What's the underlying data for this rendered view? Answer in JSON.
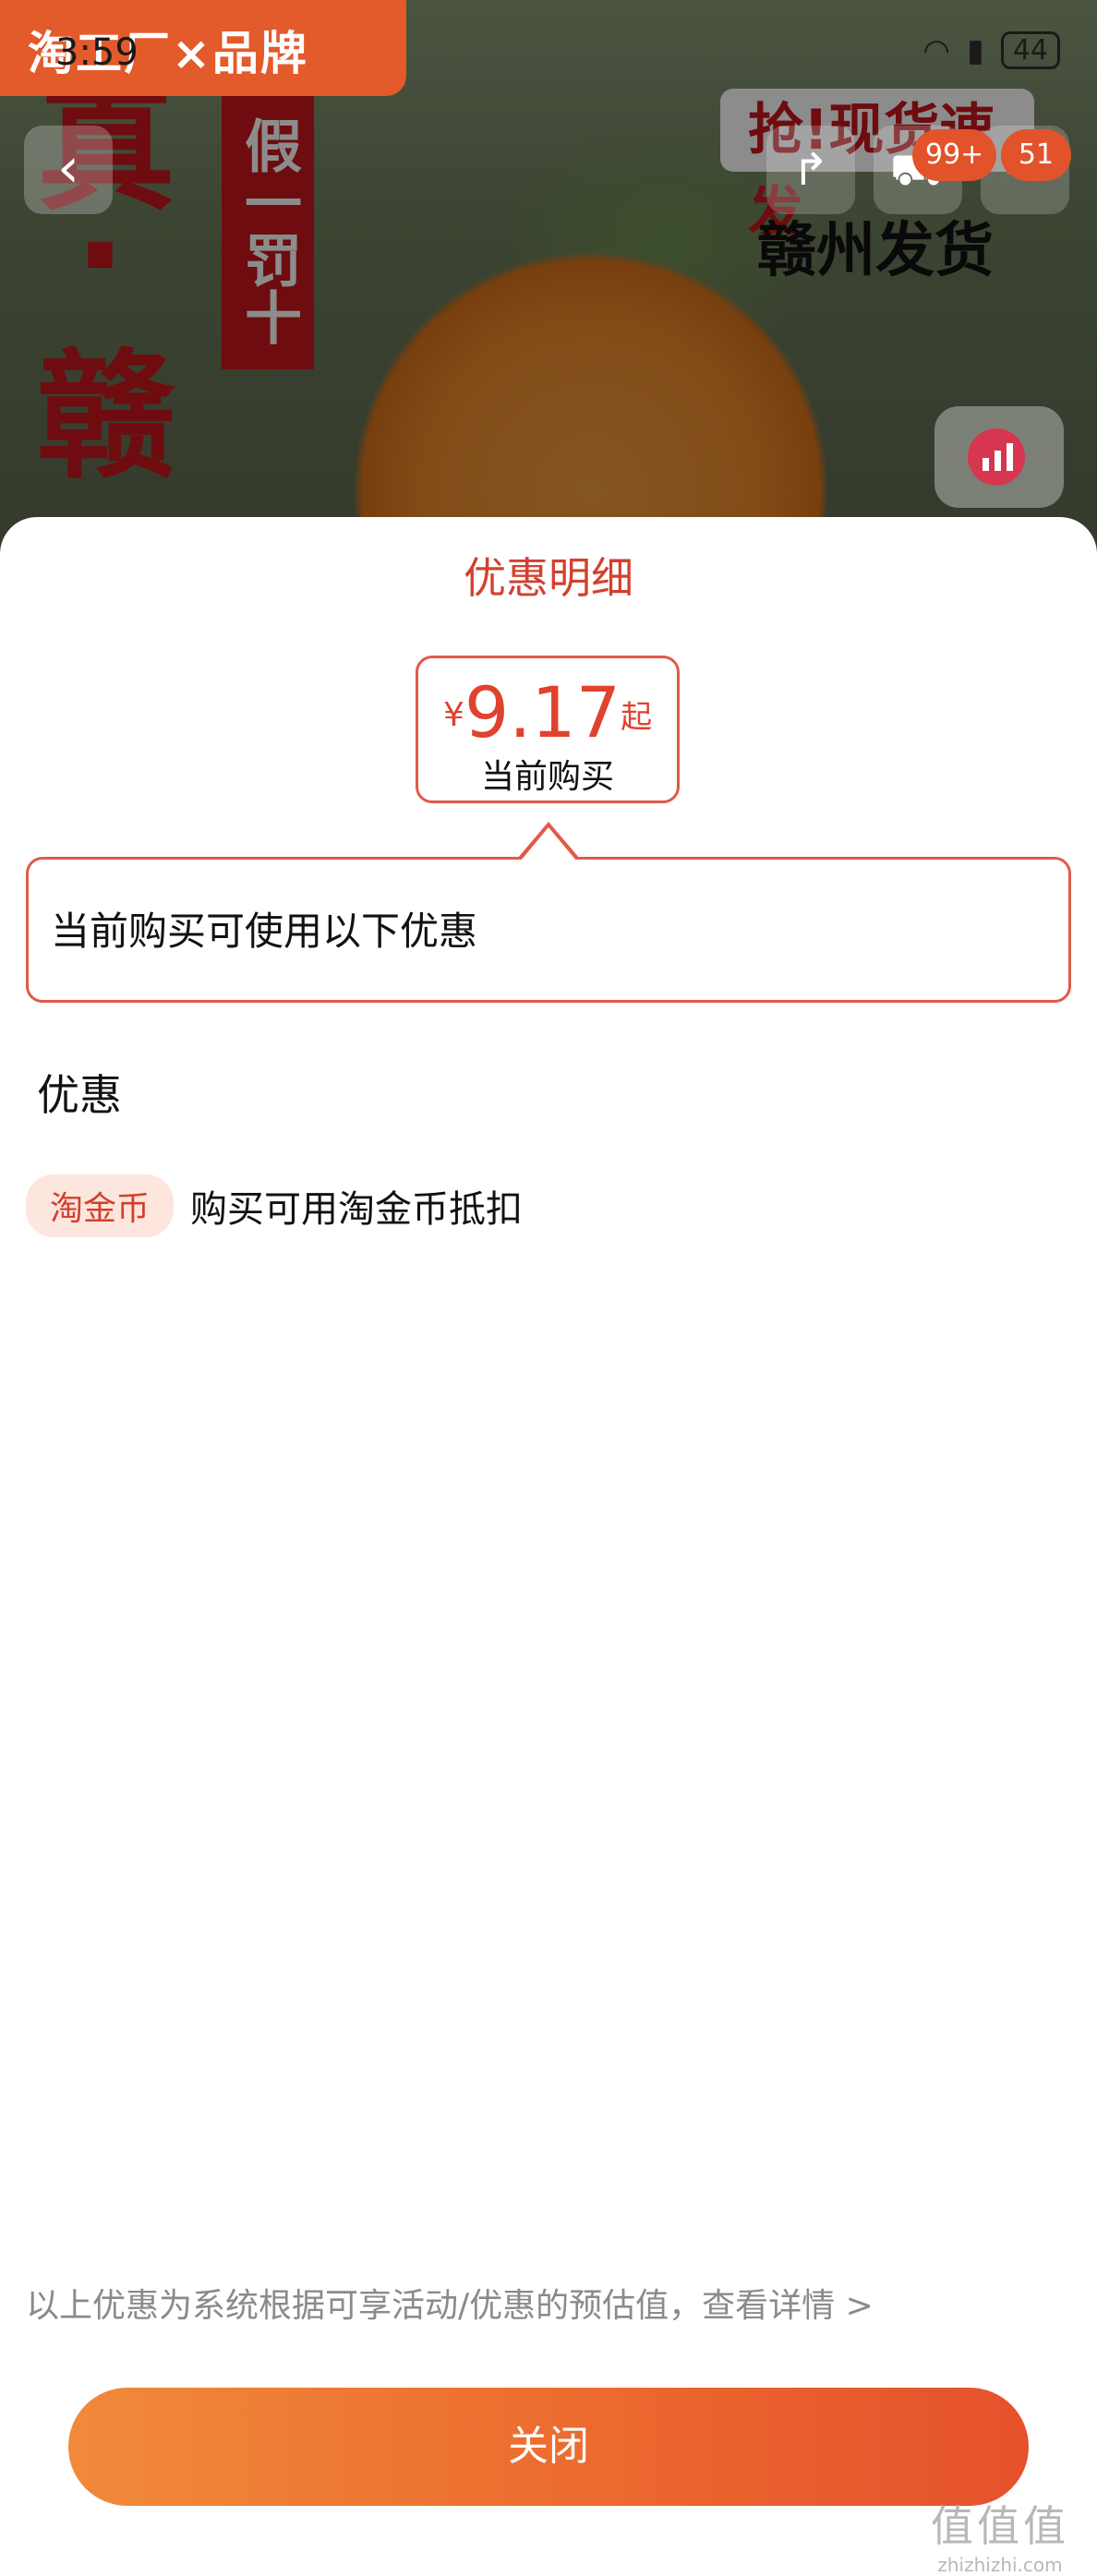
{
  "status_bar": {
    "time": "3:59",
    "battery": "44"
  },
  "background": {
    "brand_tag": "淘工厂×品牌",
    "left_banner": "假一罚十",
    "big_chars": [
      "真",
      "·",
      "赣"
    ],
    "promo_badge": "抢!现货速发",
    "promo_sub": "赣州发货",
    "cart_count": "99+",
    "message_count": "51"
  },
  "sheet": {
    "title": "优惠明细",
    "price": {
      "symbol": "¥",
      "value": "9.17",
      "suffix": "起",
      "label": "当前购买"
    },
    "info_text": "当前购买可使用以下优惠",
    "section_title": "优惠",
    "discounts": [
      {
        "tag": "淘金币",
        "text": "购买可用淘金币抵扣"
      }
    ],
    "footnote": "以上优惠为系统根据可享活动/优惠的预估值，查看详情 >",
    "close_label": "关闭"
  },
  "watermark": {
    "top": "值值值",
    "bottom": "zhizhizhi.com"
  }
}
